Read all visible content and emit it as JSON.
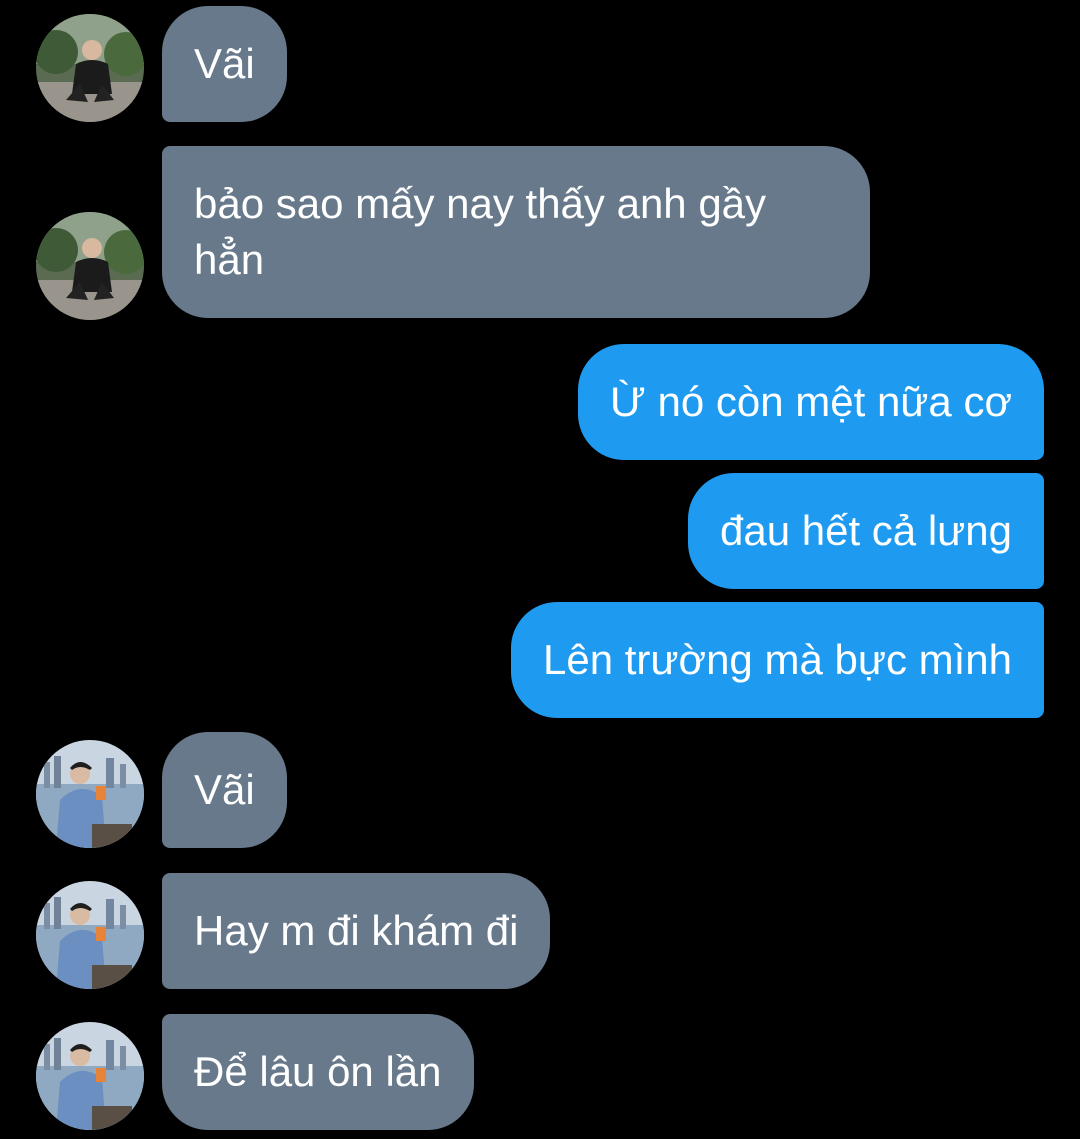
{
  "conversation": {
    "messages": [
      {
        "side": "incoming",
        "sender": "contact-a",
        "text": "Vãi"
      },
      {
        "side": "incoming",
        "sender": "contact-a",
        "text": "bảo sao mấy nay thấy anh gầy hẳn"
      },
      {
        "side": "outgoing",
        "text": "Ừ nó còn mệt nữa cơ"
      },
      {
        "side": "outgoing",
        "text": "đau hết cả lưng"
      },
      {
        "side": "outgoing",
        "text": "Lên trường mà bực mình"
      },
      {
        "side": "incoming",
        "sender": "contact-b",
        "text": "Vãi"
      },
      {
        "side": "incoming",
        "sender": "contact-b",
        "text": "Hay m đi khám đi"
      },
      {
        "side": "incoming",
        "sender": "contact-b",
        "text": "Để lâu ôn lần"
      }
    ]
  },
  "colors": {
    "background": "#000000",
    "incoming_bubble": "#67798a",
    "outgoing_bubble": "#1e9bf0",
    "text": "#ffffff"
  }
}
